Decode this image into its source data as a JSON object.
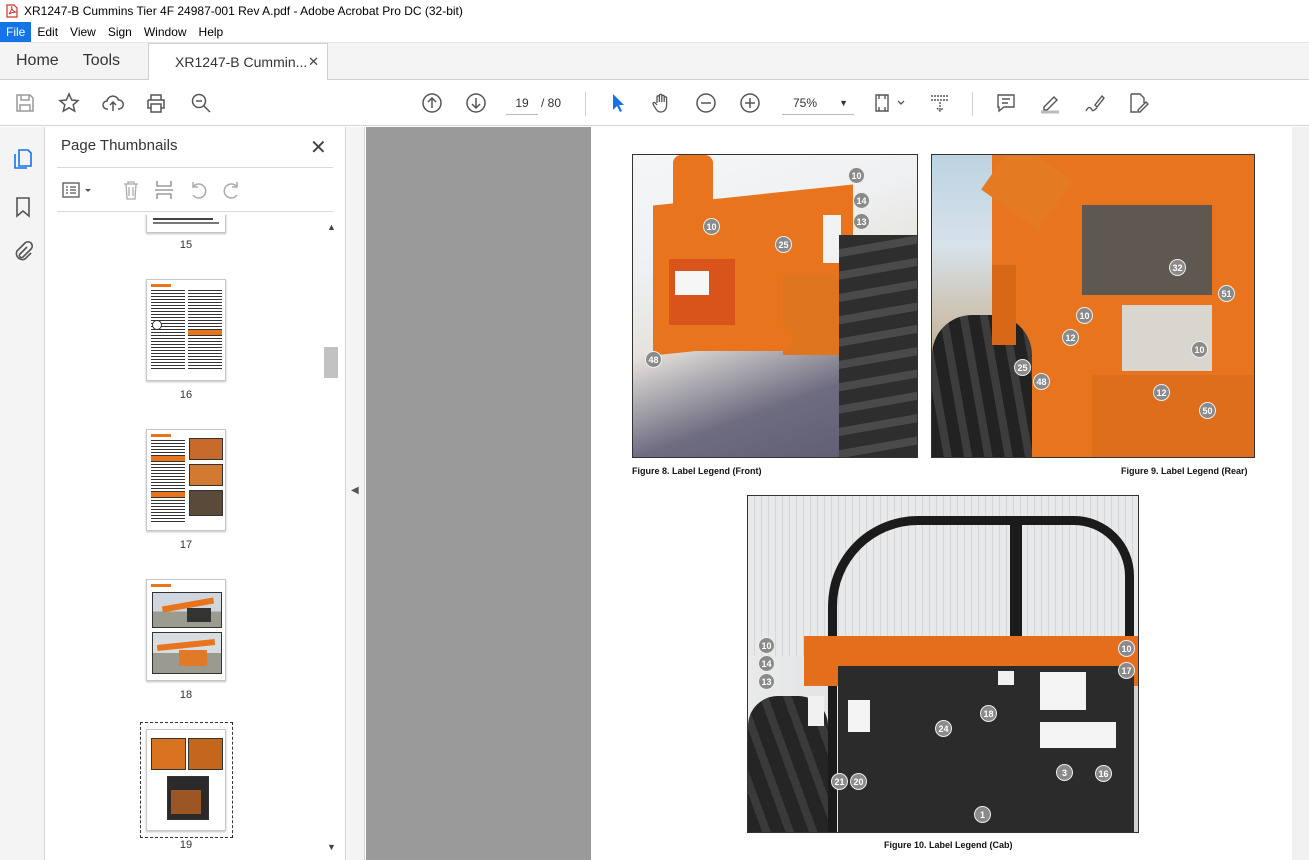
{
  "window": {
    "title": "XR1247-B Cummins Tier 4F 24987-001 Rev A.pdf - Adobe Acrobat Pro DC (32-bit)"
  },
  "menu": [
    "File",
    "Edit",
    "View",
    "Sign",
    "Window",
    "Help"
  ],
  "tabs": {
    "home": "Home",
    "tools": "Tools",
    "document": "XR1247-B Cummin..."
  },
  "toolbar": {
    "page_current": "19",
    "page_total": "/  80",
    "zoom": "75%"
  },
  "panel": {
    "title": "Page Thumbnails",
    "thumbnails": [
      {
        "label": "15"
      },
      {
        "label": "16"
      },
      {
        "label": "17"
      },
      {
        "label": "18"
      },
      {
        "label": "19"
      }
    ]
  },
  "page": {
    "fig8_caption": "Figure 8. Label Legend (Front)",
    "fig9_caption": "Figure 9. Label Legend (Rear)",
    "fig10_caption": "Figure 10. Label Legend (Cab)",
    "fig8_callouts": [
      "10",
      "14",
      "13",
      "10",
      "25",
      "48"
    ],
    "fig9_callouts": [
      "32",
      "51",
      "10",
      "12",
      "10",
      "25",
      "48",
      "12",
      "50"
    ],
    "fig10_callouts": [
      "10",
      "14",
      "13",
      "10",
      "17",
      "18",
      "24",
      "3",
      "16",
      "21",
      "20",
      "1"
    ]
  },
  "colors": {
    "accent": "#1473e6",
    "machine_orange": "#e8741e",
    "viewer_bg": "#9a9a9a"
  }
}
